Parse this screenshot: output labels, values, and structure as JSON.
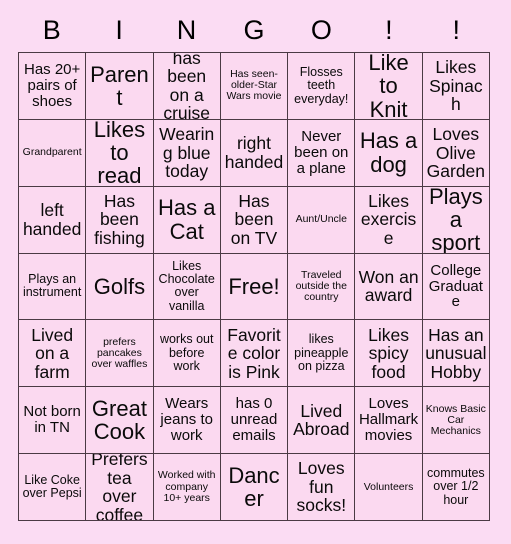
{
  "card": {
    "title": "BINGO Card",
    "background_color": "#fbdcf3",
    "cell_color": "#fbd9f0",
    "border_color": "#4a3a44",
    "text_color": "#0a0a0a"
  },
  "header": {
    "letters": [
      "B",
      "I",
      "N",
      "G",
      "O",
      "!",
      "!"
    ]
  },
  "grid": {
    "columns": 7,
    "rows": 7,
    "free_space": {
      "row": 4,
      "column": 4,
      "label": "Free!"
    },
    "cells": [
      [
        {
          "text": "Has 20+ pairs of shoes",
          "size": "md"
        },
        {
          "text": "Parent",
          "size": "xl"
        },
        {
          "text": "has been on a cruise",
          "size": "lg"
        },
        {
          "text": "Has seen-older-Star Wars movie",
          "size": "xs"
        },
        {
          "text": "Flosses teeth everyday!",
          "size": "sm"
        },
        {
          "text": "Like to Knit",
          "size": "xl"
        },
        {
          "text": "Likes Spinach",
          "size": "lg"
        }
      ],
      [
        {
          "text": "Grandparent",
          "size": "xs"
        },
        {
          "text": "Likes to read",
          "size": "xl"
        },
        {
          "text": "Wearing blue today",
          "size": "lg"
        },
        {
          "text": "right handed",
          "size": "lg"
        },
        {
          "text": "Never been on a plane",
          "size": "md"
        },
        {
          "text": "Has a dog",
          "size": "xl"
        },
        {
          "text": "Loves Olive Garden",
          "size": "lg"
        }
      ],
      [
        {
          "text": "left handed",
          "size": "lg"
        },
        {
          "text": "Has been fishing",
          "size": "lg"
        },
        {
          "text": "Has a Cat",
          "size": "xl"
        },
        {
          "text": "Has been on TV",
          "size": "lg"
        },
        {
          "text": "Aunt/Uncle",
          "size": "xs"
        },
        {
          "text": "Likes exercise",
          "size": "lg"
        },
        {
          "text": "Plays a sport",
          "size": "xl"
        }
      ],
      [
        {
          "text": "Plays an instrument",
          "size": "sm"
        },
        {
          "text": "Golfs",
          "size": "xl"
        },
        {
          "text": "Likes Chocolate over vanilla",
          "size": "sm"
        },
        {
          "text": "Free!",
          "size": "xl"
        },
        {
          "text": "Traveled outside the country",
          "size": "xs"
        },
        {
          "text": "Won an award",
          "size": "lg"
        },
        {
          "text": "College Graduate",
          "size": "md"
        }
      ],
      [
        {
          "text": "Lived on a farm",
          "size": "lg"
        },
        {
          "text": "prefers pancakes over waffles",
          "size": "xs"
        },
        {
          "text": "works out before work",
          "size": "sm"
        },
        {
          "text": "Favorite color is Pink",
          "size": "lg"
        },
        {
          "text": "likes pineapple on pizza",
          "size": "sm"
        },
        {
          "text": "Likes spicy food",
          "size": "lg"
        },
        {
          "text": "Has an unusual Hobby",
          "size": "lg"
        }
      ],
      [
        {
          "text": "Not born in TN",
          "size": "md"
        },
        {
          "text": "Great Cook",
          "size": "xl"
        },
        {
          "text": "Wears jeans to work",
          "size": "md"
        },
        {
          "text": "has 0 unread emails",
          "size": "md"
        },
        {
          "text": "Lived Abroad",
          "size": "lg"
        },
        {
          "text": "Loves Hallmark movies",
          "size": "md"
        },
        {
          "text": "Knows Basic Car Mechanics",
          "size": "xs"
        }
      ],
      [
        {
          "text": "Like Coke over Pepsi",
          "size": "sm"
        },
        {
          "text": "Prefers tea over coffee",
          "size": "lg"
        },
        {
          "text": "Worked with company 10+ years",
          "size": "xs"
        },
        {
          "text": "Dancer",
          "size": "xl"
        },
        {
          "text": "Loves fun socks!",
          "size": "lg"
        },
        {
          "text": "Volunteers",
          "size": "xs"
        },
        {
          "text": "commutes over 1/2 hour",
          "size": "sm"
        }
      ]
    ]
  }
}
